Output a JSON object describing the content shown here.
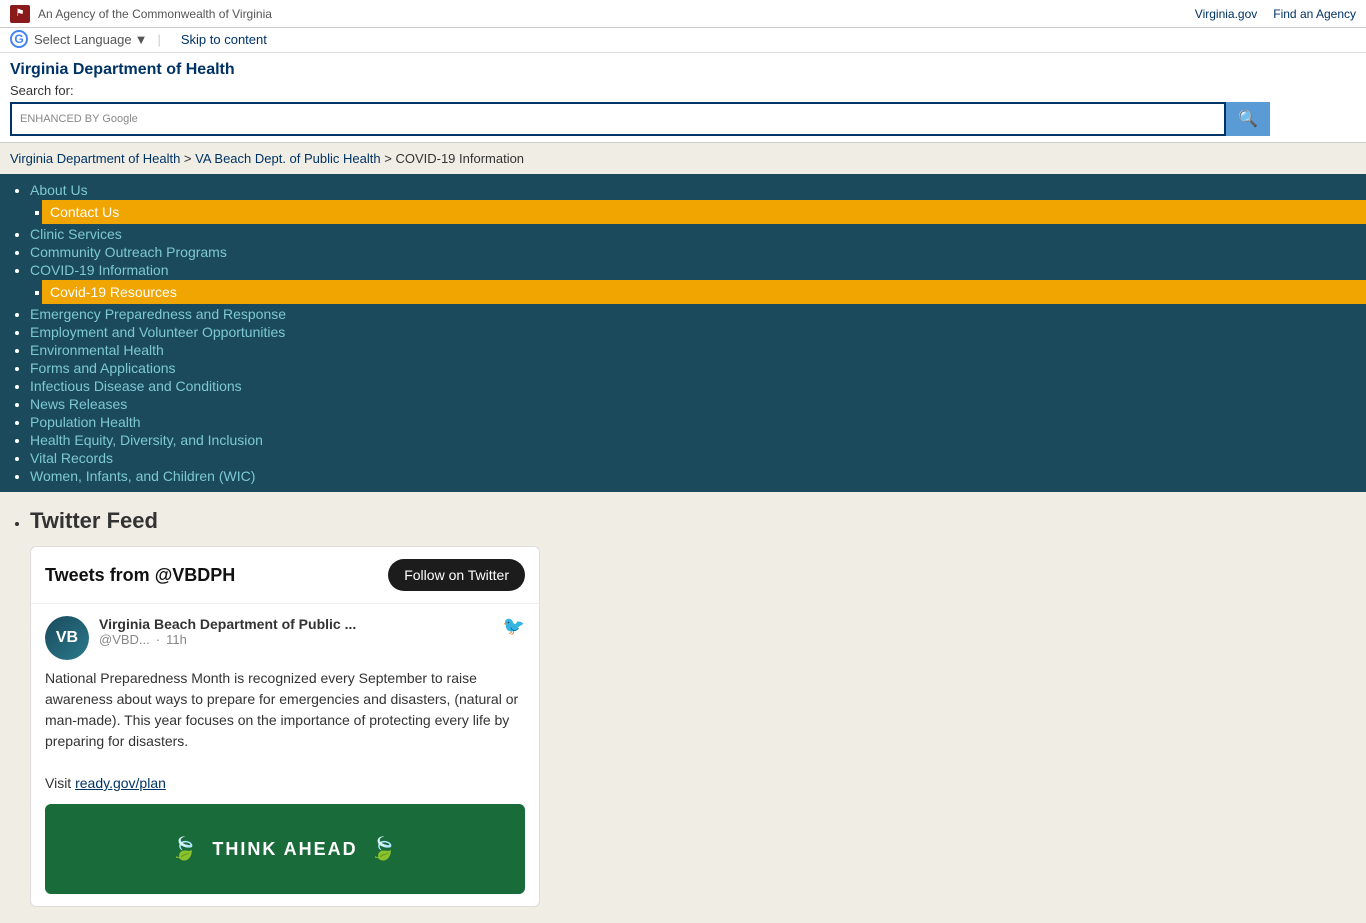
{
  "topbar": {
    "agency_text": "An Agency of the Commonwealth of Virginia",
    "link1": "Virginia.gov",
    "link2": "Find an Agency"
  },
  "language": {
    "select_label": "Select Language",
    "skip_label": "Skip to content"
  },
  "header": {
    "site_title": "Virginia Department of Health",
    "search_label": "Search for:",
    "search_placeholder": "",
    "enhanced_by": "ENHANCED BY Google",
    "search_btn_icon": "🔍"
  },
  "breadcrumb": {
    "crumb1": "Virginia Department of Health",
    "separator1": " > ",
    "crumb2": "VA Beach Dept. of Public Health",
    "separator2": " > ",
    "current": "COVID-19 Information"
  },
  "nav": {
    "items": [
      {
        "label": "About Us",
        "sub": [
          {
            "label": "Contact Us",
            "highlight": true
          }
        ]
      },
      {
        "label": "Clinic Services",
        "sub": []
      },
      {
        "label": "Community Outreach Programs",
        "sub": []
      },
      {
        "label": "COVID-19 Information",
        "sub": [
          {
            "label": "Covid-19 Resources",
            "highlight": true
          }
        ]
      },
      {
        "label": "Emergency Preparedness and Response",
        "sub": []
      },
      {
        "label": "Employment and Volunteer Opportunities",
        "sub": []
      },
      {
        "label": "Environmental Health",
        "sub": []
      },
      {
        "label": "Forms and Applications",
        "sub": []
      },
      {
        "label": "Infectious Disease and Conditions",
        "sub": []
      },
      {
        "label": "News Releases",
        "sub": []
      },
      {
        "label": "Population Health",
        "sub": []
      },
      {
        "label": "Health Equity, Diversity, and Inclusion",
        "sub": []
      },
      {
        "label": "Vital Records",
        "sub": []
      },
      {
        "label": "Women, Infants, and Children (WIC)",
        "sub": []
      }
    ]
  },
  "main": {
    "twitter_section_title": "Twitter Feed",
    "twitter_widget": {
      "title": "Tweets from @VBDPH",
      "follow_label": "Follow on Twitter",
      "tweet": {
        "user_name": "Virginia Beach Department of Public ...",
        "handle": "@VBD...",
        "time_ago": "11h",
        "body_line1": "National Preparedness Month is recognized every September to raise awareness about ways to prepare for emergencies and disasters, (natural or man-made).  This year focuses on the importance of protecting every life by preparing for disasters.",
        "visit_text": "Visit",
        "link_text": "ready.gov/plan",
        "image_text": "THINK AHEAD"
      }
    }
  }
}
